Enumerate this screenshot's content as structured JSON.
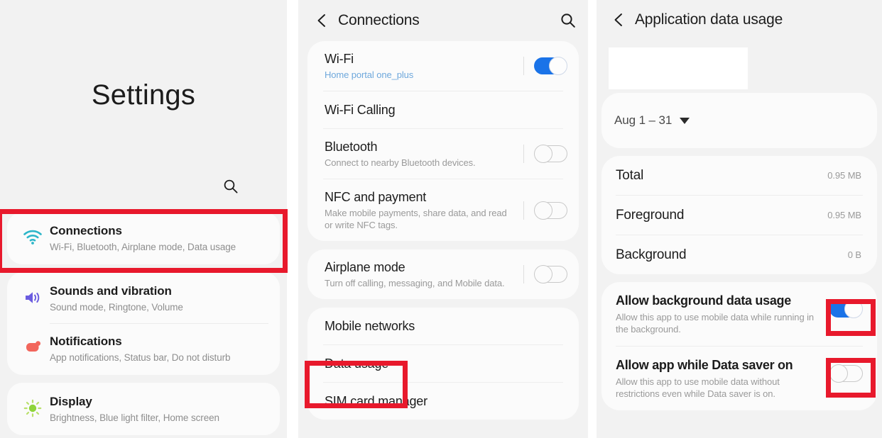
{
  "settings_panel": {
    "title": "Settings",
    "search_icon": "search-icon",
    "groups": [
      {
        "items": [
          {
            "icon": "wifi-icon",
            "icon_color": "#2db6c9",
            "title": "Connections",
            "subtitle": "Wi-Fi, Bluetooth, Airplane mode, Data usage",
            "highlighted": true
          }
        ]
      },
      {
        "items": [
          {
            "icon": "speaker-icon",
            "icon_color": "#6b5ce0",
            "title": "Sounds and vibration",
            "subtitle": "Sound mode, Ringtone, Volume",
            "highlighted": false
          },
          {
            "icon": "notification-icon",
            "icon_color": "#f2665c",
            "title": "Notifications",
            "subtitle": "App notifications, Status bar, Do not disturb",
            "highlighted": false
          }
        ]
      },
      {
        "items": [
          {
            "icon": "brightness-sun-icon",
            "icon_color": "#7ac943",
            "title": "Display",
            "subtitle": "Brightness, Blue light filter, Home screen",
            "highlighted": false
          }
        ]
      }
    ]
  },
  "connections_panel": {
    "header": {
      "back_icon": "chevron-left-icon",
      "title": "Connections",
      "search_icon": "search-icon"
    },
    "groups": [
      {
        "rows": [
          {
            "title": "Wi-Fi",
            "subtitle": "Home portal one_plus",
            "subtitle_style": "blue",
            "toggle": "on"
          },
          {
            "title": "Wi-Fi Calling",
            "subtitle": "",
            "toggle": "none"
          },
          {
            "title": "Bluetooth",
            "subtitle": "Connect to nearby Bluetooth devices.",
            "toggle": "off"
          },
          {
            "title": "NFC and payment",
            "subtitle": "Make mobile payments, share data, and read or write NFC tags.",
            "toggle": "off"
          }
        ]
      },
      {
        "rows": [
          {
            "title": "Airplane mode",
            "subtitle": "Turn off calling, messaging, and Mobile data.",
            "toggle": "off"
          }
        ]
      },
      {
        "rows": [
          {
            "title": "Mobile networks",
            "subtitle": "",
            "toggle": "none"
          },
          {
            "title": "Data usage",
            "subtitle": "",
            "toggle": "none",
            "highlighted": true
          },
          {
            "title": "SIM card manager",
            "subtitle": "",
            "toggle": "none"
          }
        ]
      }
    ]
  },
  "app_data_usage_panel": {
    "header": {
      "back_icon": "chevron-left-icon",
      "title": "Application data usage"
    },
    "period": {
      "label": "Aug 1 – 31",
      "caret_icon": "caret-down-icon"
    },
    "usage_rows": [
      {
        "label": "Total",
        "value": "0.95 MB"
      },
      {
        "label": "Foreground",
        "value": "0.95 MB"
      },
      {
        "label": "Background",
        "value": "0 B"
      }
    ],
    "settings": [
      {
        "title": "Allow background data usage",
        "subtitle": "Allow this app to use mobile data while running in the background.",
        "toggle": "on",
        "highlighted": true
      },
      {
        "title": "Allow app while Data saver on",
        "subtitle": "Allow this app to use mobile data without restrictions even while Data saver is on.",
        "toggle": "off",
        "highlighted": true
      }
    ]
  },
  "annotation": {
    "highlight_color": "#e8192c"
  }
}
